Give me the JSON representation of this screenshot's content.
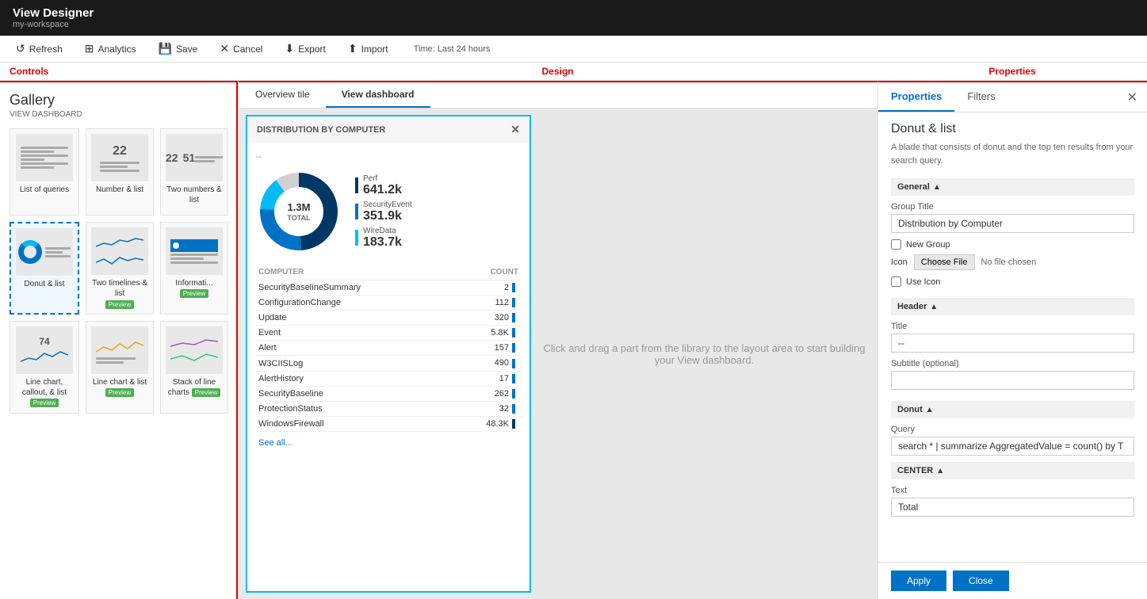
{
  "titlebar": {
    "app_title": "View Designer",
    "workspace": "my-workspace"
  },
  "toolbar": {
    "refresh": "Refresh",
    "analytics": "Analytics",
    "save": "Save",
    "cancel": "Cancel",
    "export": "Export",
    "import": "Import",
    "time_label": "Time: Last 24 hours"
  },
  "section_labels": {
    "controls": "Controls",
    "design": "Design",
    "properties": "Properties"
  },
  "gallery": {
    "title": "Gallery",
    "subtitle": "VIEW DASHBOARD",
    "items": [
      {
        "label": "List of queries",
        "type": "list"
      },
      {
        "label": "Number & list",
        "type": "number",
        "num1": "22"
      },
      {
        "label": "Two numbers & list",
        "type": "two_numbers",
        "num1": "22",
        "num2": "51"
      },
      {
        "label": "Donut & list",
        "type": "donut",
        "selected": true
      },
      {
        "label": "Two timelines & list",
        "type": "timelines",
        "preview": true
      },
      {
        "label": "Informati... Preview",
        "type": "info",
        "preview": true
      },
      {
        "label": "Line chart, callout, & list",
        "type": "line_callout",
        "num": "74",
        "preview": true
      },
      {
        "label": "Line chart & list",
        "type": "line_list",
        "preview": true
      },
      {
        "label": "Stack of line charts",
        "type": "stack_line",
        "preview": true
      }
    ]
  },
  "design": {
    "tabs": [
      {
        "label": "Overview tile",
        "active": false
      },
      {
        "label": "View dashboard",
        "active": true
      }
    ],
    "tile": {
      "header": "DISTRIBUTION BY COMPUTER",
      "subtitle": "--",
      "donut": {
        "total": "1.3M",
        "total_label": "TOTAL"
      },
      "legend": [
        {
          "name": "Perf",
          "value": "641.2k",
          "color": "#003865"
        },
        {
          "name": "SecurityEvent",
          "value": "351.9k",
          "color": "#0072c6"
        },
        {
          "name": "WireData",
          "value": "183.7k",
          "color": "#00bcf2"
        }
      ],
      "table_headers": [
        "COMPUTER",
        "COUNT"
      ],
      "table_rows": [
        {
          "name": "SecurityBaselineSummary",
          "count": "2",
          "bar_size": "tiny"
        },
        {
          "name": "ConfigurationChange",
          "count": "112",
          "bar_size": "small"
        },
        {
          "name": "Update",
          "count": "320",
          "bar_size": "small"
        },
        {
          "name": "Event",
          "count": "5.8K",
          "bar_size": "medium"
        },
        {
          "name": "Alert",
          "count": "157",
          "bar_size": "small"
        },
        {
          "name": "W3CIISLog",
          "count": "490",
          "bar_size": "small"
        },
        {
          "name": "AlertHistory",
          "count": "17",
          "bar_size": "tiny"
        },
        {
          "name": "SecurityBaseline",
          "count": "262",
          "bar_size": "small"
        },
        {
          "name": "ProtectionStatus",
          "count": "32",
          "bar_size": "tiny"
        },
        {
          "name": "WindowsFirewall",
          "count": "48.3K",
          "bar_size": "large"
        }
      ],
      "see_all": "See all..."
    },
    "empty_message": "Click and drag a part from the library to the layout area to start\nbuilding your View dashboard."
  },
  "properties": {
    "tabs": [
      {
        "label": "Properties",
        "active": true
      },
      {
        "label": "Filters",
        "active": false
      }
    ],
    "section_title": "Donut & list",
    "section_desc": "A blade that consists of donut and the top ten results from your search query.",
    "general": {
      "header": "General",
      "group_title_label": "Group Title",
      "group_title_value": "Distribution by Computer",
      "new_group_label": "New Group",
      "new_group_checked": false,
      "icon_label": "Icon",
      "choose_file_btn": "Choose File",
      "no_file_text": "No file chosen",
      "use_icon_label": "Use Icon",
      "use_icon_checked": false
    },
    "header_section": {
      "header": "Header",
      "title_label": "Title",
      "title_value": "--",
      "subtitle_label": "Subtitle (optional)",
      "subtitle_value": ""
    },
    "donut_section": {
      "header": "Donut",
      "query_label": "Query",
      "query_value": "search * | summarize AggregatedValue = count() by T",
      "center_header": "CENTER",
      "text_label": "Text",
      "text_value": "Total"
    },
    "footer": {
      "apply": "Apply",
      "close": "Close"
    }
  }
}
